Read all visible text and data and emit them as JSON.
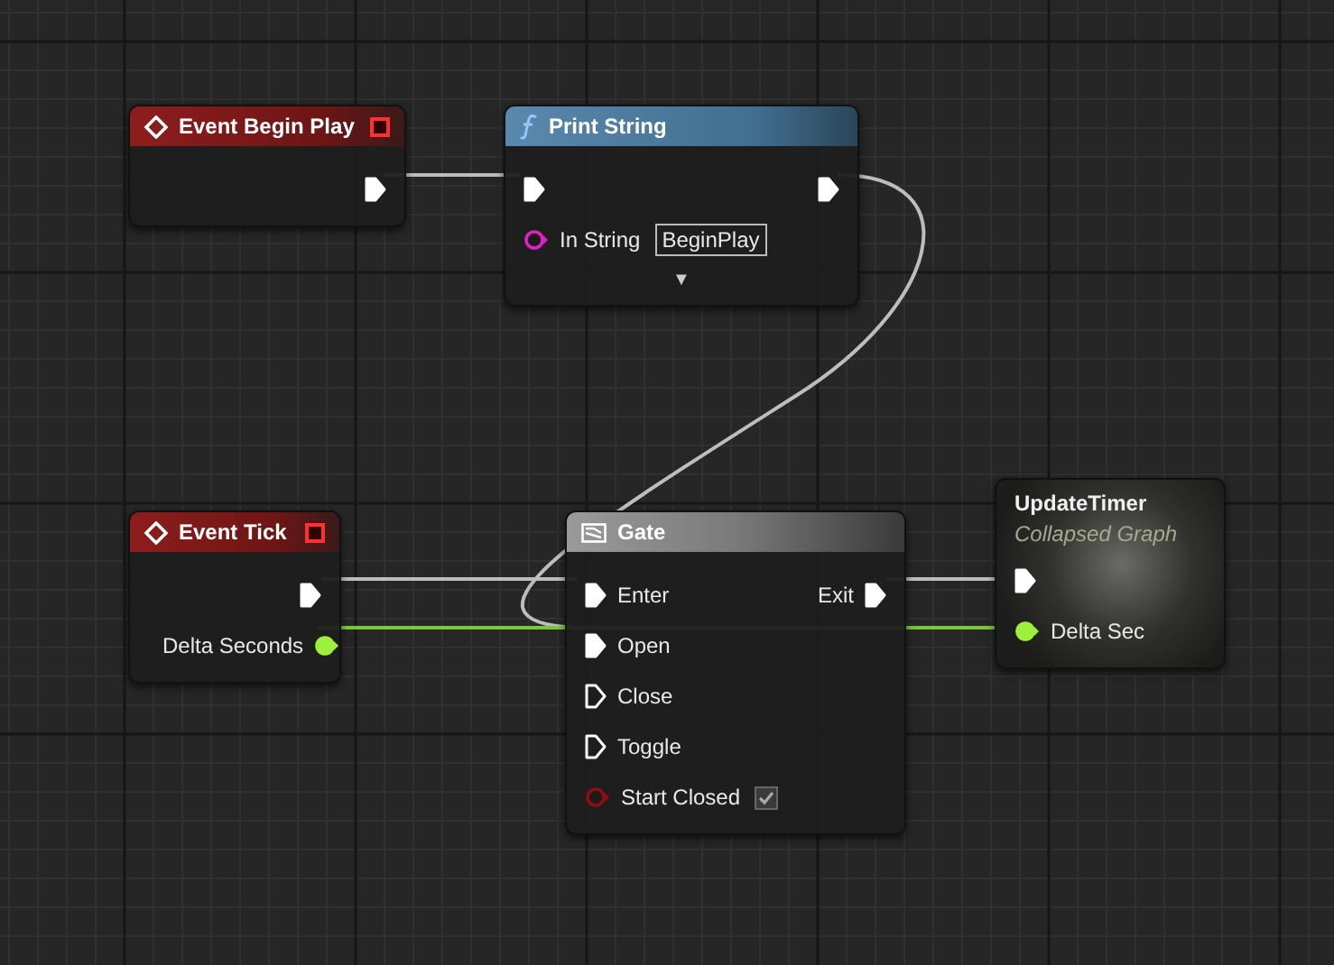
{
  "nodes": [
    {
      "kind": "event",
      "title": "Event Begin Play",
      "outputs": [
        {
          "kind": "exec",
          "connected": true
        }
      ]
    },
    {
      "kind": "function",
      "title": "Print String",
      "inputs": [
        {
          "kind": "exec",
          "connected": true
        },
        {
          "kind": "string",
          "label": "In String",
          "value": "BeginPlay",
          "connected": false
        }
      ],
      "outputs": [
        {
          "kind": "exec",
          "connected": true
        }
      ],
      "advanced": "▼"
    },
    {
      "kind": "event",
      "title": "Event Tick",
      "outputs": [
        {
          "kind": "exec",
          "connected": true
        },
        {
          "kind": "float",
          "label": "Delta Seconds",
          "connected": true
        }
      ]
    },
    {
      "kind": "macro",
      "title": "Gate",
      "inputs": [
        {
          "kind": "exec",
          "label": "Enter",
          "connected": true
        },
        {
          "kind": "exec",
          "label": "Open",
          "connected": true
        },
        {
          "kind": "exec",
          "label": "Close",
          "connected": false
        },
        {
          "kind": "exec",
          "label": "Toggle",
          "connected": false
        },
        {
          "kind": "bool",
          "label": "Start Closed",
          "connected": false,
          "checked": true
        }
      ],
      "outputs": [
        {
          "kind": "exec",
          "label": "Exit",
          "connected": true
        }
      ]
    },
    {
      "kind": "collapsed",
      "title": "UpdateTimer",
      "subtitle": "Collapsed Graph",
      "inputs": [
        {
          "kind": "exec",
          "connected": true
        },
        {
          "kind": "float",
          "label": "Delta Sec",
          "connected": true
        }
      ]
    }
  ]
}
